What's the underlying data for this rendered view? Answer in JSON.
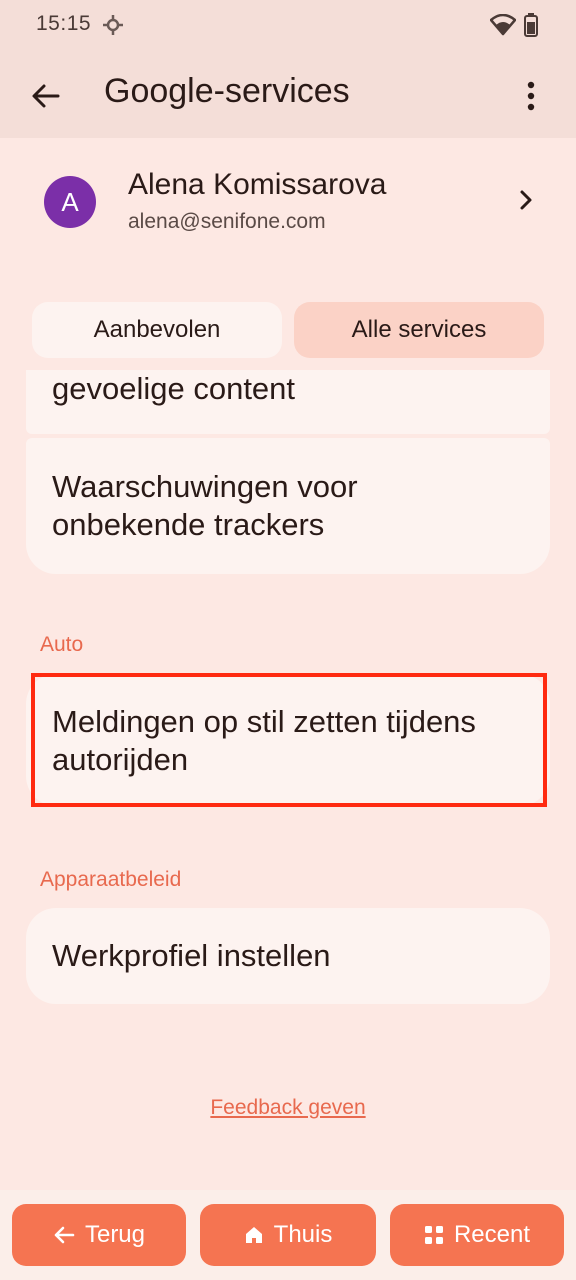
{
  "status": {
    "time": "15:15"
  },
  "appbar": {
    "title": "Google-services"
  },
  "account": {
    "initial": "A",
    "name": "Alena Komissarova",
    "email": "alena@senifone.com"
  },
  "tabs": [
    {
      "label": "Aanbevolen",
      "selected": false
    },
    {
      "label": "Alle services",
      "selected": true
    }
  ],
  "items": [
    {
      "label": "gevoelige content"
    },
    {
      "label": "Waarschuwingen voor onbekende trackers"
    }
  ],
  "sections": [
    {
      "title": "Auto",
      "items": [
        {
          "label": "Meldingen op stil zetten tijdens autorijden"
        }
      ]
    },
    {
      "title": "Apparaatbeleid",
      "items": [
        {
          "label": "Werkprofiel instellen"
        }
      ]
    }
  ],
  "feedback": "Feedback geven",
  "nav": {
    "back": "Terug",
    "home": "Thuis",
    "recent": "Recent"
  },
  "colors": {
    "accent": "#f57451",
    "section": "#e8694e",
    "highlight": "#ff2a10"
  }
}
